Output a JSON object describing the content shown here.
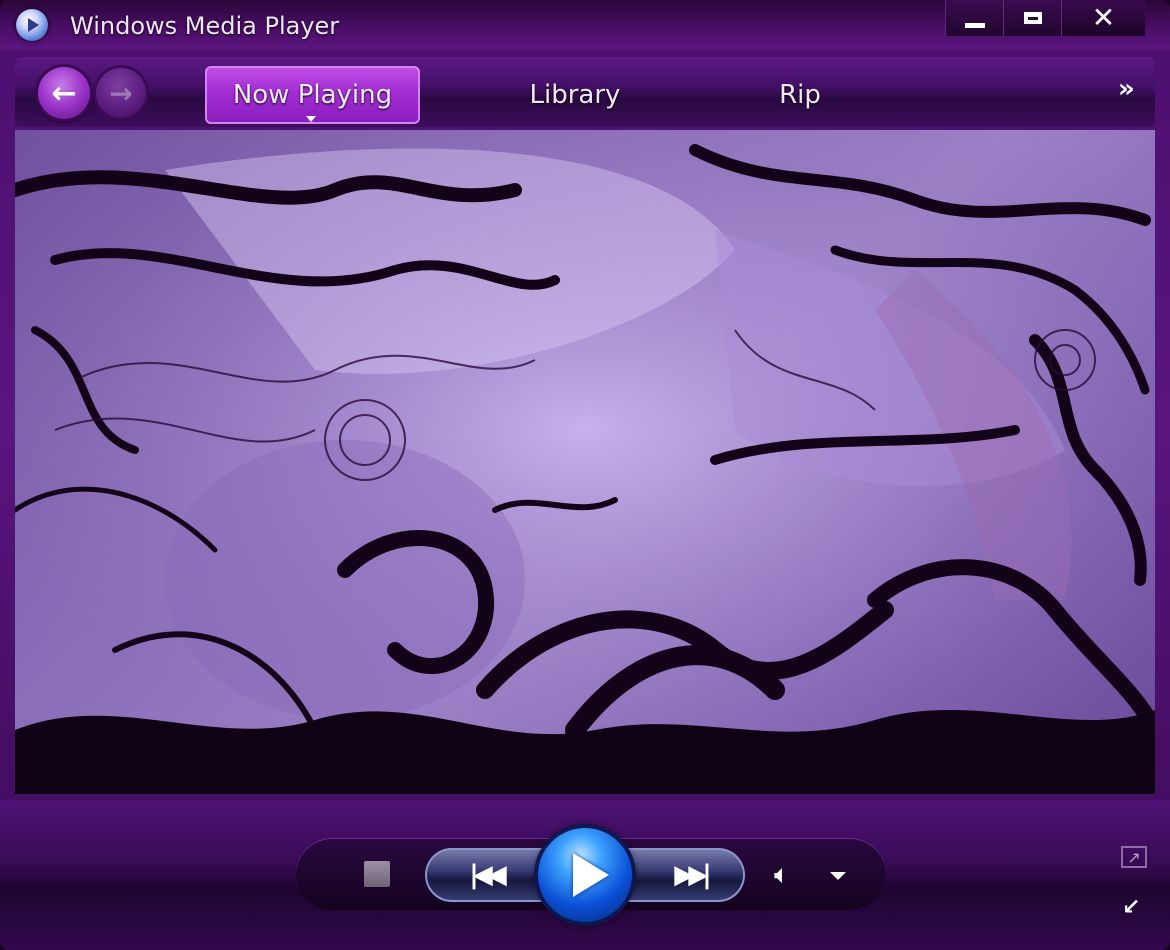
{
  "window": {
    "title": "Windows Media Player",
    "controls": {
      "minimize": "minimize",
      "maximize": "maximize",
      "close": "close"
    }
  },
  "nav": {
    "back_icon": "back-arrow-icon",
    "forward_icon": "forward-arrow-icon",
    "tabs": [
      {
        "label": "Now Playing",
        "active": true
      },
      {
        "label": "Library",
        "active": false
      },
      {
        "label": "Rip",
        "active": false
      }
    ],
    "more_icon": "double-chevron-right-icon"
  },
  "playback": {
    "stop_icon": "stop-icon",
    "prev_icon": "previous-track-icon",
    "play_icon": "play-icon",
    "next_icon": "next-track-icon",
    "volume_icon": "speaker-icon",
    "volume_menu_icon": "dropdown-caret-icon"
  },
  "theme": {
    "accent": "#a22ed3",
    "frame": "#4b0f6e",
    "play_button": "#0a4fd6"
  }
}
